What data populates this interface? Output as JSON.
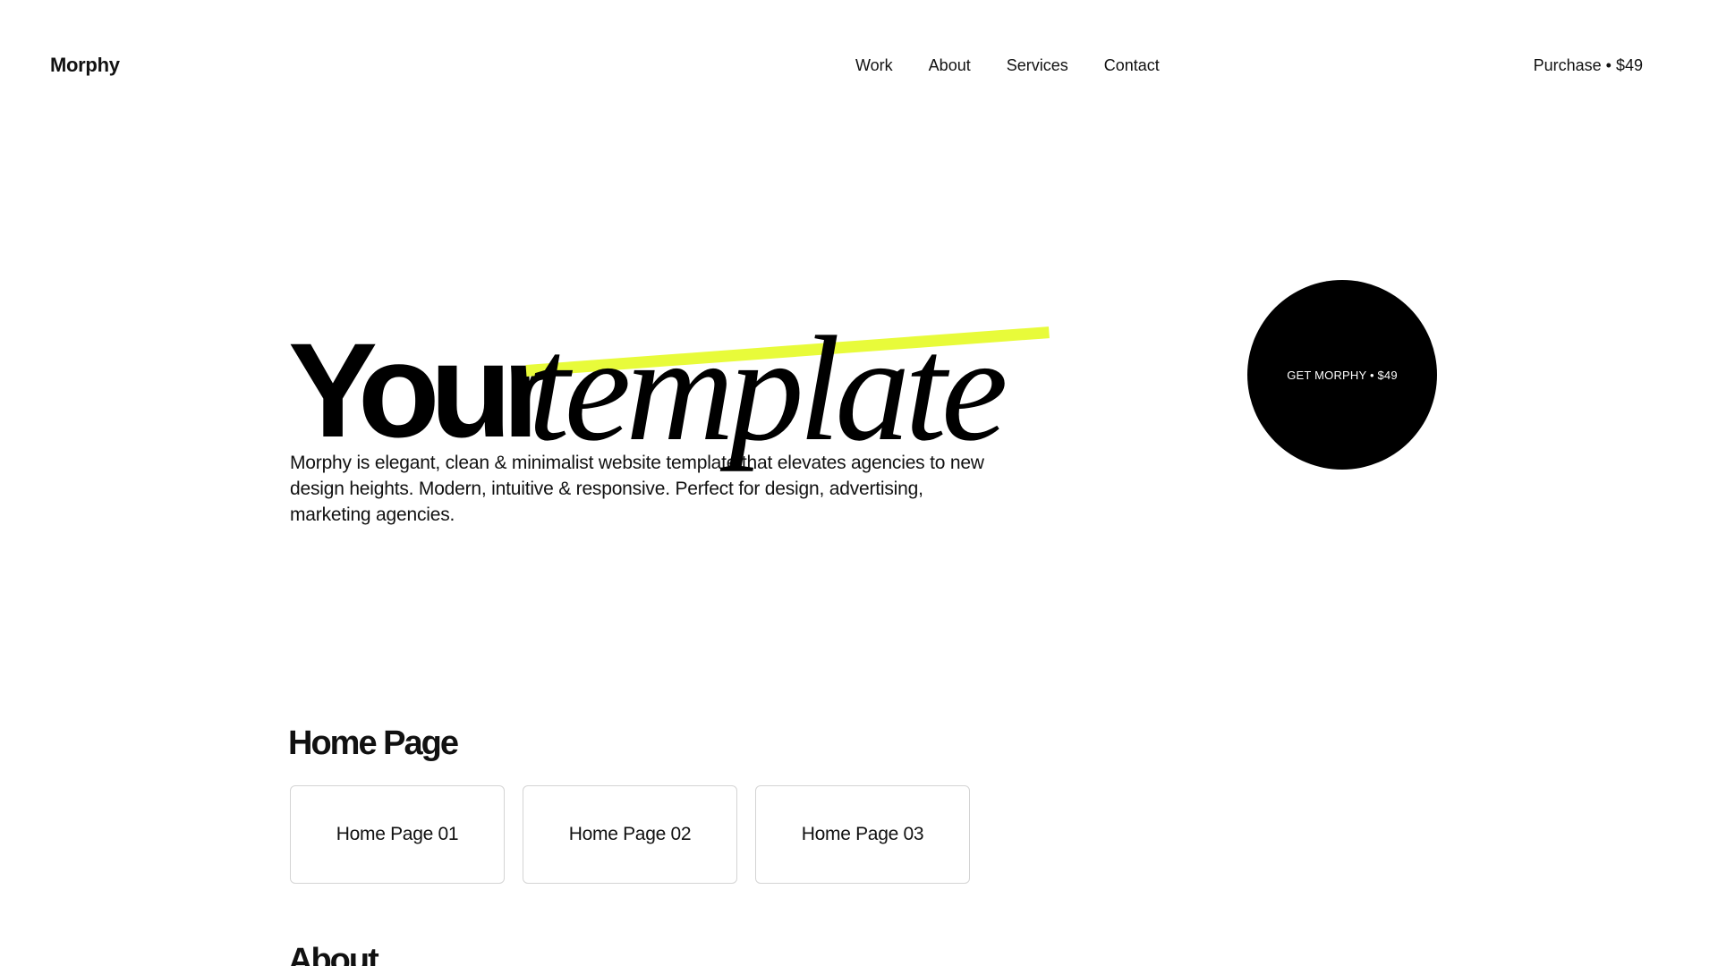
{
  "header": {
    "logo": "Morphy",
    "nav": [
      {
        "label": "Work"
      },
      {
        "label": "About"
      },
      {
        "label": "Services"
      },
      {
        "label": "Contact"
      }
    ],
    "purchase": "Purchase • $49"
  },
  "hero": {
    "title_bold": "Your",
    "title_italic": "template",
    "description": "Morphy is elegant, clean & minimalist website template that elevates agencies to new design heights. Modern, intuitive & responsive. Perfect for design, advertising, marketing agencies.",
    "cta": "GET MORPHY • $49",
    "highlight_color": "#e8fb3a"
  },
  "home_section": {
    "title": "Home Page",
    "cards": [
      {
        "label": "Home Page 01"
      },
      {
        "label": "Home Page 02"
      },
      {
        "label": "Home Page 03"
      }
    ]
  },
  "about_section": {
    "title": "About"
  }
}
